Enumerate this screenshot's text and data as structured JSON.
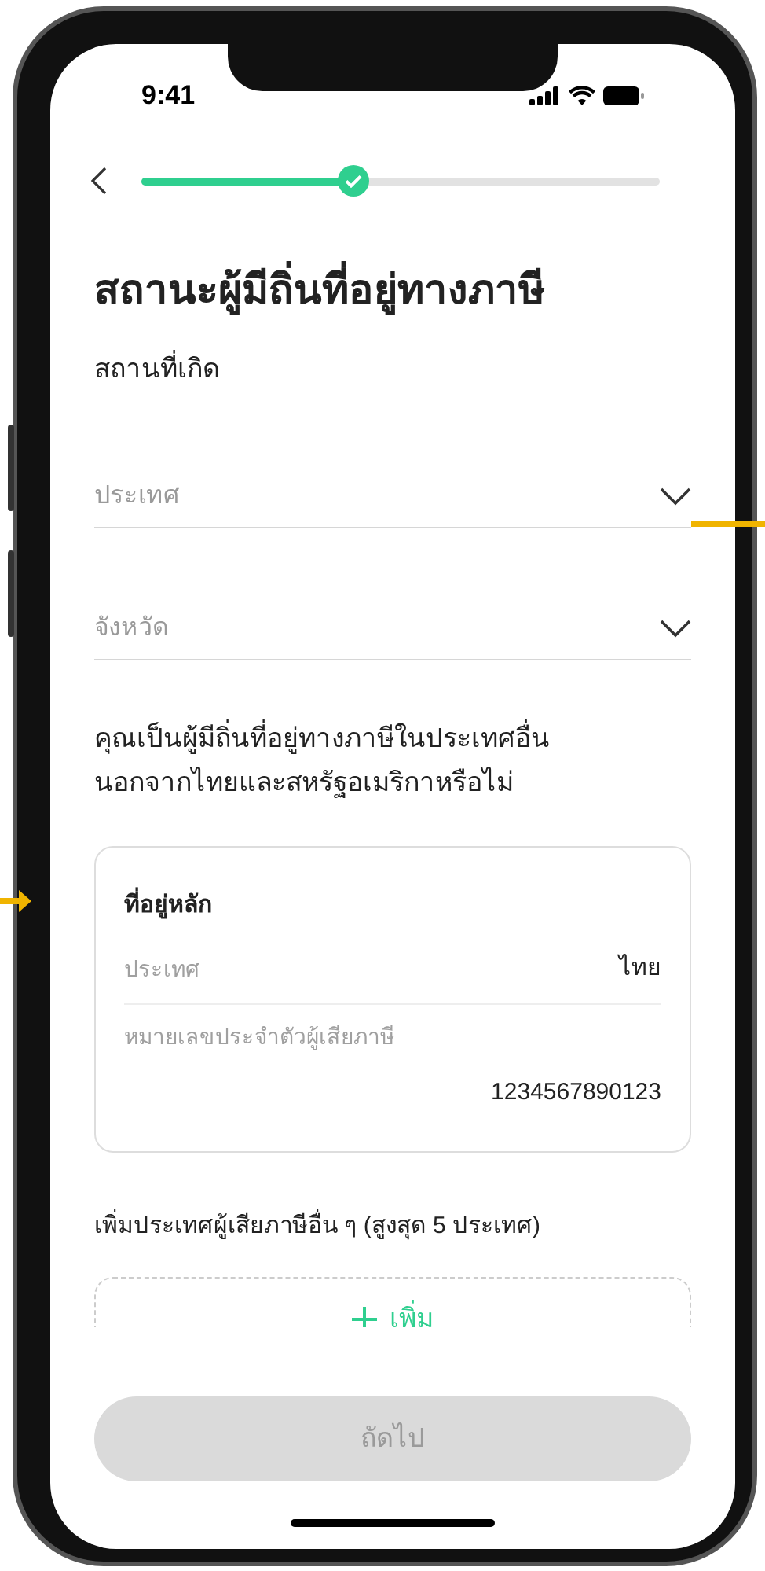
{
  "status_bar": {
    "time": "9:41"
  },
  "progress": {
    "level": 0.41,
    "step_done": true
  },
  "title": "สถานะผู้มีถิ่นที่อยู่ทางภาษี",
  "birthplace": {
    "label": "สถานที่เกิด",
    "fields": [
      {
        "placeholder": "ประเทศ"
      },
      {
        "placeholder": "จังหวัด"
      }
    ]
  },
  "question": "คุณเป็นผู้มีถิ่นที่อยู่ทางภาษีในประเทศอื่นนอกจากไทยและสหรัฐอเมริกาหรือไม่",
  "residence_card": {
    "title": "ที่อยู่หลัก",
    "rows": [
      {
        "label": "ประเทศ",
        "value": "ไทย",
        "kind": "inline"
      },
      {
        "label": "หมายเลขประจำตัวผู้เสียภาษี",
        "value": "1234567890123",
        "kind": "stacked"
      }
    ]
  },
  "add_section": {
    "label": "เพิ่มประเทศผู้เสียภาษีอื่น ๆ (สูงสุด 5 ประเทศ)",
    "button": "เพิ่ม"
  },
  "next_button": {
    "label": "ถัดไป",
    "disabled": true
  }
}
